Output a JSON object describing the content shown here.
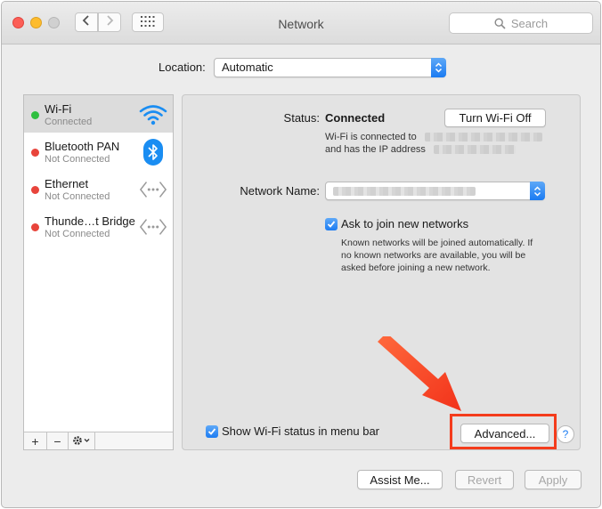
{
  "window": {
    "title": "Network",
    "search_placeholder": "Search"
  },
  "location": {
    "label": "Location:",
    "value": "Automatic"
  },
  "services": [
    {
      "name": "Wi-Fi",
      "status": "Connected",
      "status_color": "#2fbf3f",
      "icon": "wifi-icon",
      "selected": true
    },
    {
      "name": "Bluetooth PAN",
      "status": "Not Connected",
      "status_color": "#e8443b",
      "icon": "bluetooth-icon",
      "selected": false
    },
    {
      "name": "Ethernet",
      "status": "Not Connected",
      "status_color": "#e8443b",
      "icon": "ethernet-icon",
      "selected": false
    },
    {
      "name": "Thunde…t Bridge",
      "status": "Not Connected",
      "status_color": "#e8443b",
      "icon": "thunderbolt-bridge-icon",
      "selected": false
    }
  ],
  "sidebar_controls": {
    "add": "+",
    "remove": "−"
  },
  "detail": {
    "status_label": "Status:",
    "status_value": "Connected",
    "toggle_button": "Turn Wi-Fi Off",
    "status_desc_1": "Wi-Fi is connected to",
    "status_desc_2": "and has the IP address",
    "network_name_label": "Network Name:",
    "ask_join_label": "Ask to join new networks",
    "ask_join_checked": true,
    "ask_join_desc_1": "Known networks will be joined automatically. If",
    "ask_join_desc_2": "no known networks are available, you will be",
    "ask_join_desc_3": "asked before joining a new network.",
    "show_status_label": "Show Wi-Fi status in menu bar",
    "show_status_checked": true,
    "advanced_button": "Advanced...",
    "help": "?"
  },
  "footer": {
    "assist": "Assist Me...",
    "revert": "Revert",
    "apply": "Apply"
  },
  "annotation": {
    "color": "#f43c1c"
  }
}
